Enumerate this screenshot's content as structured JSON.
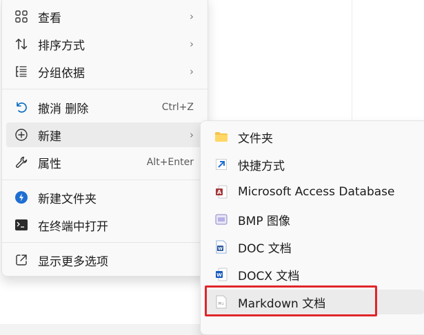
{
  "main_menu": {
    "view": "查看",
    "sort_by": "排序方式",
    "group_by": "分组依据",
    "undo_delete": "撤消 删除",
    "undo_shortcut": "Ctrl+Z",
    "new": "新建",
    "properties": "属性",
    "properties_shortcut": "Alt+Enter",
    "new_folder": "新建文件夹",
    "open_in_terminal": "在终端中打开",
    "show_more_options": "显示更多选项"
  },
  "submenu": {
    "items": [
      {
        "label": "文件夹",
        "icon": "folder-icon"
      },
      {
        "label": "快捷方式",
        "icon": "shortcut-icon"
      },
      {
        "label": "Microsoft Access Database",
        "icon": "access-icon"
      },
      {
        "label": "BMP 图像",
        "icon": "bmp-image-icon"
      },
      {
        "label": "DOC 文档",
        "icon": "doc-icon"
      },
      {
        "label": "DOCX 文档",
        "icon": "docx-icon"
      },
      {
        "label": "Markdown 文档",
        "icon": "markdown-file-icon"
      }
    ]
  },
  "colors": {
    "highlight_border": "#e0252a",
    "accent": "#0067c0"
  }
}
